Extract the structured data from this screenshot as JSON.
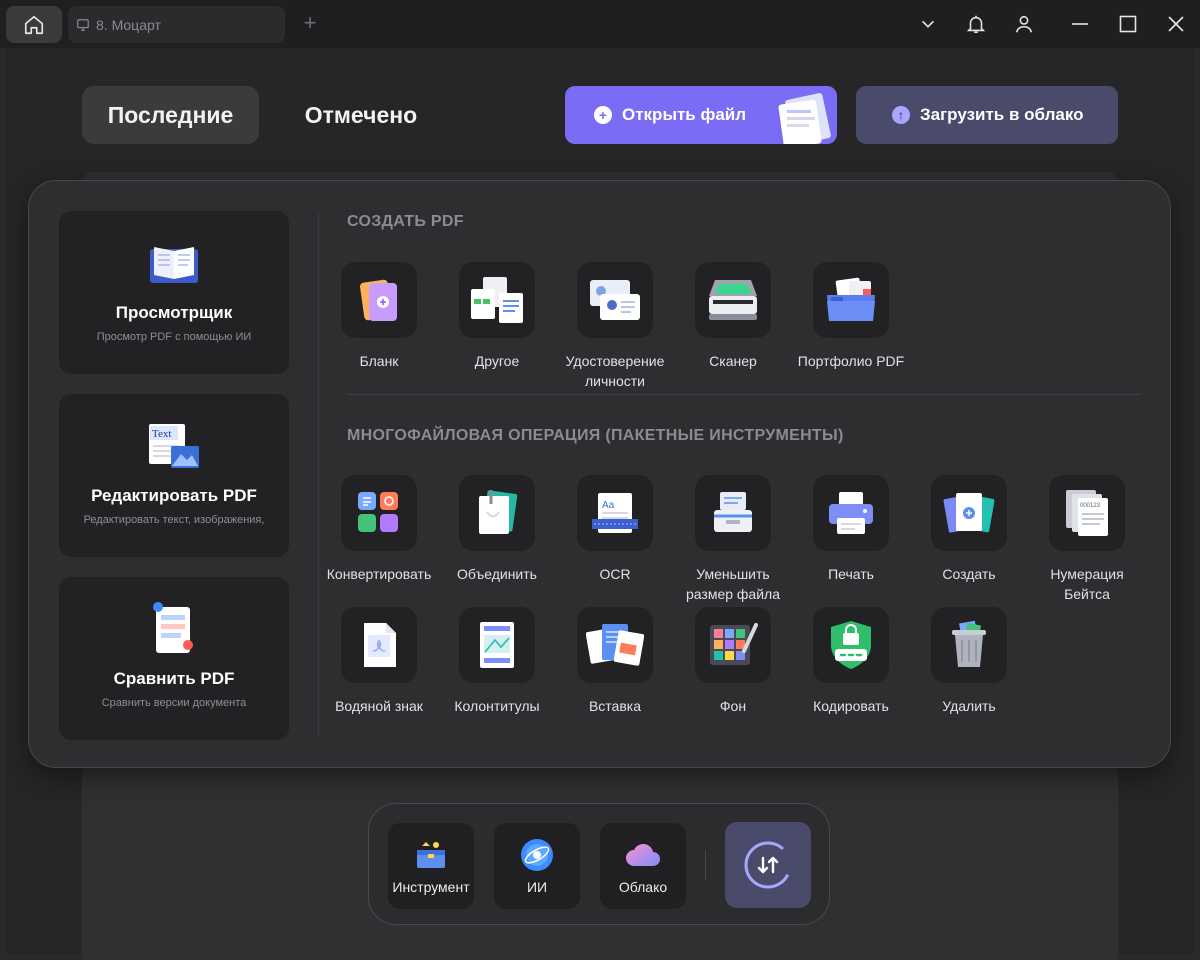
{
  "titlebar": {
    "tab_label": "8. Моцарт",
    "new_tab_symbol": "+",
    "icons": [
      "home-icon",
      "monitor-icon",
      "chevron-down-icon",
      "bell-icon",
      "user-icon",
      "minimize-icon",
      "maximize-icon",
      "close-icon"
    ]
  },
  "top_tabs": {
    "recent": "Последние",
    "starred": "Отмечено"
  },
  "actions": {
    "open_file": "Открыть файл",
    "upload_cloud": "Загрузить в облако"
  },
  "features": [
    {
      "title": "Просмотрщик",
      "subtitle": "Просмотр PDF с помощью ИИ"
    },
    {
      "title": "Редактировать PDF",
      "subtitle": "Редактировать текст, изображения,"
    },
    {
      "title": "Сравнить PDF",
      "subtitle": "Сравнить версии документа"
    }
  ],
  "edit_icon_text": "Text",
  "sections": {
    "create": "СОЗДАТЬ PDF",
    "batch": "МНОГОФАЙЛОВАЯ ОПЕРАЦИЯ (ПАКЕТНЫЕ ИНСТРУМЕНТЫ)"
  },
  "create_tools": [
    {
      "label": "Бланк",
      "icon": "blank-doc-icon"
    },
    {
      "label": "Другое",
      "icon": "other-docs-icon"
    },
    {
      "label": "Удостоверение\nличности",
      "icon": "id-card-icon"
    },
    {
      "label": "Сканер",
      "icon": "scanner-icon"
    },
    {
      "label": "Портфолио PDF",
      "icon": "portfolio-icon"
    }
  ],
  "batch_tools": [
    {
      "label": "Конвертировать",
      "icon": "convert-icon"
    },
    {
      "label": "Объединить",
      "icon": "merge-icon"
    },
    {
      "label": "OCR",
      "icon": "ocr-icon"
    },
    {
      "label": "Уменьшить\nразмер файла",
      "icon": "compress-icon"
    },
    {
      "label": "Печать",
      "icon": "printer-icon"
    },
    {
      "label": "Создать",
      "icon": "create-icon"
    },
    {
      "label": "Нумерация\nБейтса",
      "icon": "bates-icon"
    },
    {
      "label": "Водяной знак",
      "icon": "watermark-icon"
    },
    {
      "label": "Колонтитулы",
      "icon": "header-footer-icon"
    },
    {
      "label": "Вставка",
      "icon": "insert-icon"
    },
    {
      "label": "Фон",
      "icon": "background-icon"
    },
    {
      "label": "Кодировать",
      "icon": "encrypt-icon"
    },
    {
      "label": "Удалить",
      "icon": "trash-icon"
    }
  ],
  "bates_icon_text": "000123",
  "ocr_icon_text": "Aa",
  "dock": {
    "tools": "Инструмент",
    "ai": "ИИ",
    "cloud": "Облако"
  },
  "colors": {
    "accent": "#7b6cf6",
    "upload_btn": "#4a4a6a",
    "bg": "#262628",
    "panel": "#2e2e31",
    "card": "#222224"
  }
}
